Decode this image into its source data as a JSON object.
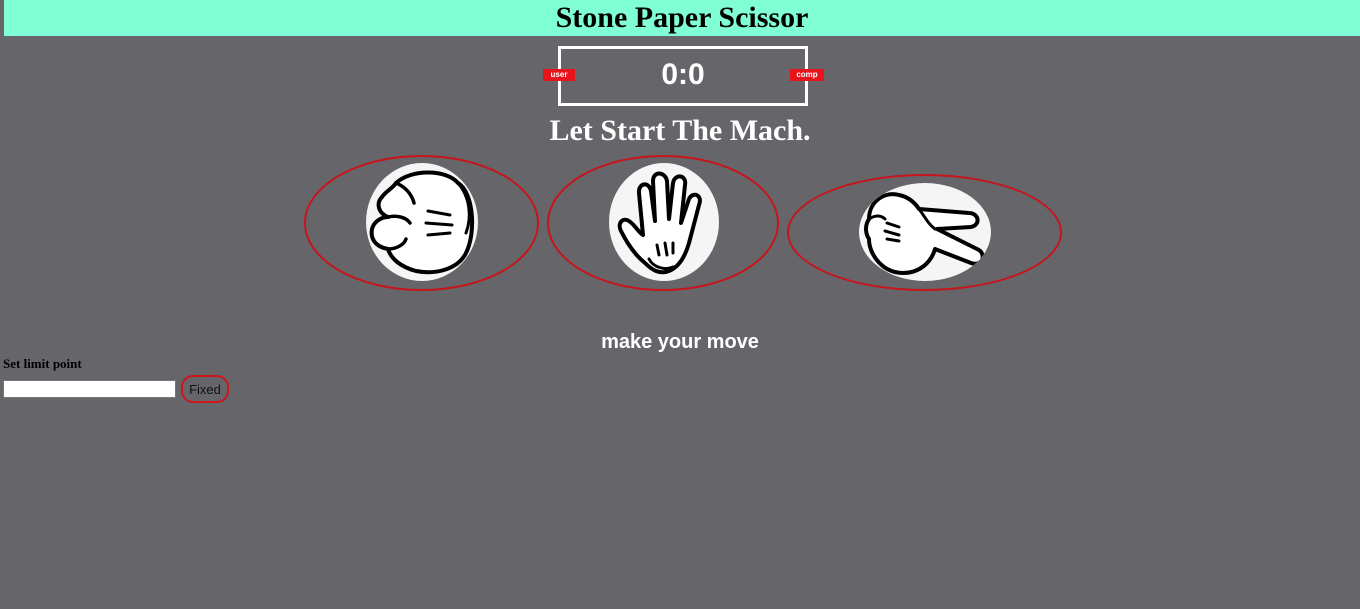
{
  "header": {
    "title": "Stone Paper Scissor"
  },
  "scoreboard": {
    "score": "0:0",
    "user_tag": "user",
    "comp_tag": "comp"
  },
  "subtitle": "Let Start The Mach.",
  "choices": [
    {
      "name": "stone",
      "icon": "fist-icon"
    },
    {
      "name": "paper",
      "icon": "open-hand-icon"
    },
    {
      "name": "scissor",
      "icon": "scissor-hand-icon"
    }
  ],
  "message": "make your move",
  "limit": {
    "label": "Set limit point",
    "input_value": "",
    "button_label": "Fixed"
  },
  "colors": {
    "background": "#66656a",
    "header": "#80ffd4",
    "accent_red": "#e8141b"
  }
}
